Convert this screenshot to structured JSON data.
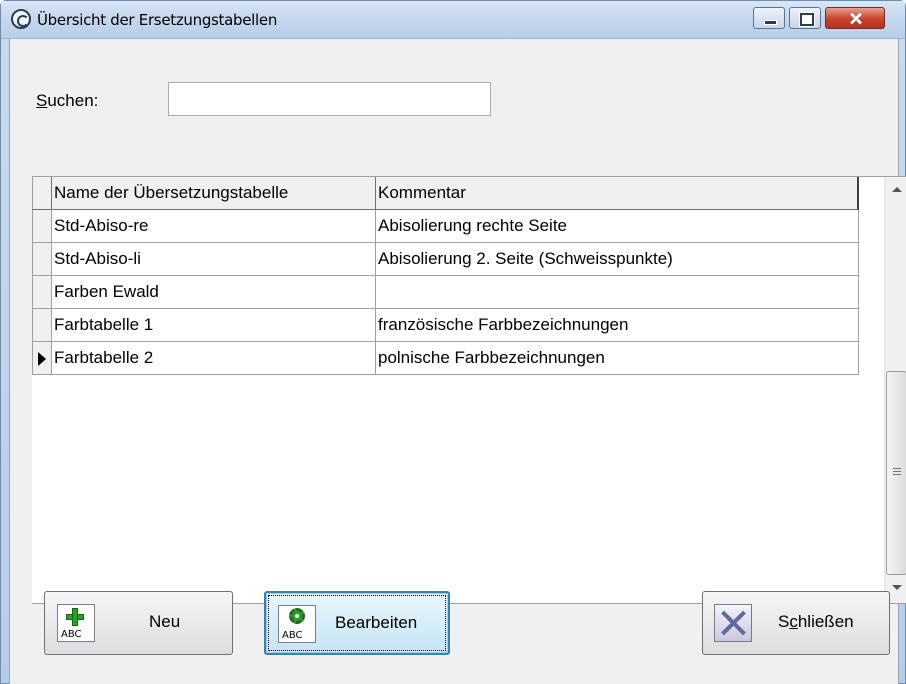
{
  "window": {
    "title": "Übersicht der Ersetzungstabellen",
    "controls": [
      "minimize",
      "maximize",
      "close"
    ]
  },
  "search": {
    "label_prefix": "S",
    "label_rest": "uchen:",
    "value": "",
    "placeholder": ""
  },
  "grid": {
    "columns": [
      "Name der Übersetzungstabelle",
      "Kommentar"
    ],
    "rows": [
      {
        "name": "Std-Abiso-re",
        "comment": "Abisolierung rechte Seite"
      },
      {
        "name": "Std-Abiso-li",
        "comment": "Abisolierung 2. Seite (Schweisspunkte)"
      },
      {
        "name": "Farben Ewald",
        "comment": ""
      },
      {
        "name": "Farbtabelle 1",
        "comment": "französische Farbbezeichnungen"
      },
      {
        "name": "Farbtabelle 2",
        "comment": "polnische Farbbezeichnungen"
      }
    ],
    "current_row_index": 4
  },
  "buttons": {
    "new_label": "Neu",
    "edit_label": "Bearbeiten",
    "close_prefix": "S",
    "close_hotkey": "c",
    "close_rest": "hließen",
    "icon_text": "ABC"
  },
  "icons": {
    "title": "app-logo-icon",
    "new": "add-abc-icon",
    "edit": "gear-abc-icon",
    "close": "close-x-icon"
  }
}
